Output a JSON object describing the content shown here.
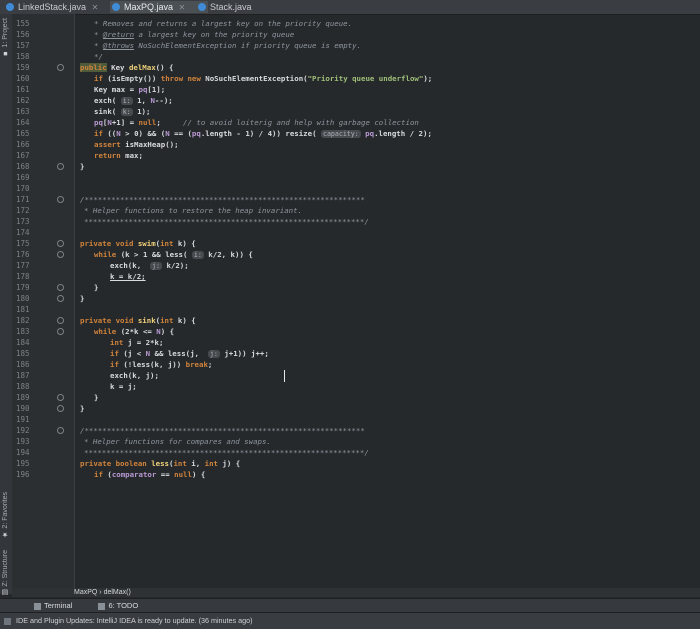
{
  "tabs": [
    {
      "label": "LinkedStack.java",
      "active": false
    },
    {
      "label": "MaxPQ.java",
      "active": true
    },
    {
      "label": "Stack.java",
      "active": false
    }
  ],
  "toolstrip": {
    "project": "1: Project",
    "favorites": "2: Favorites",
    "structure": "Z: Structure"
  },
  "gutter": {
    "line_numbers": [
      "155",
      "156",
      "157",
      "158",
      "159",
      "160",
      "161",
      "162",
      "163",
      "164",
      "165",
      "166",
      "167",
      "168",
      "169",
      "170",
      "171",
      "172",
      "173",
      "174",
      "175",
      "176",
      "177",
      "178",
      "179",
      "180",
      "181",
      "182",
      "183",
      "184",
      "185",
      "186",
      "187",
      "188",
      "189",
      "190",
      "191",
      "192",
      "193",
      "194",
      "195",
      "196"
    ]
  },
  "code": {
    "l155_a": "* Removes and returns a largest key on the priority queue.",
    "l156_a": "* ",
    "l156_tag": "@return",
    "l156_b": " a largest key on the priority queue",
    "l157_a": "* ",
    "l157_tag": "@throws",
    "l157_b": " NoSuchElementException if priority queue is empty.",
    "l158": "*/",
    "l159_kw": "public",
    "l159_b": " Key ",
    "l159_m": "delMax",
    "l159_c": "() {",
    "l160_kw": "if",
    "l160_b": " (isEmpty()) ",
    "l160_kw2": "throw new",
    "l160_c": " NoSuchElementException(",
    "l160_str": "\"Priority queue underflow\"",
    "l160_d": ");",
    "l161_a": "Key max = ",
    "l161_f": "pq",
    "l161_b": "[1];",
    "l162_a": "exch( ",
    "l162_h": "i:",
    "l162_b": " 1, ",
    "l162_f": "N",
    "l162_c": "--);",
    "l163_a": "sink( ",
    "l163_h": "k:",
    "l163_b": " 1);",
    "l164_f": "pq",
    "l164_a": "[",
    "l164_f2": "N",
    "l164_b": "+1] = ",
    "l164_kw": "null",
    "l164_c": ";     ",
    "l164_com": "// to avoid loiterig and help with garbage collection",
    "l165_kw": "if",
    "l165_a": " ((",
    "l165_f": "N",
    "l165_b": " > 0) && (",
    "l165_f2": "N",
    "l165_c": " == (",
    "l165_f3": "pq",
    "l165_d": ".length - 1) / 4)) resize( ",
    "l165_h": "capacity:",
    "l165_e": " ",
    "l165_f4": "pq",
    "l165_g": ".length / 2);",
    "l166_kw": "assert",
    "l166_a": " isMaxHeap();",
    "l167_kw": "return",
    "l167_a": " max;",
    "l168": "}",
    "l171": "/***************************************************************",
    "l172": "* Helper functions to restore the heap invariant.",
    "l173": "***************************************************************/",
    "l175_kw": "private void",
    "l175_m": " swim",
    "l175_a": "(",
    "l175_kw2": "int",
    "l175_b": " k) {",
    "l176_kw": "while",
    "l176_a": " (k > 1 && less( ",
    "l176_h": "i:",
    "l176_b": " k/2, k)) {",
    "l177_a": "exch(k,  ",
    "l177_h": "j:",
    "l177_b": " k/2);",
    "l178_a": "k = k/2;",
    "l179": "}",
    "l180": "}",
    "l182_kw": "private void",
    "l182_m": " sink",
    "l182_a": "(",
    "l182_kw2": "int",
    "l182_b": " k) {",
    "l183_kw": "while",
    "l183_a": " (2*k <= ",
    "l183_f": "N",
    "l183_b": ") {",
    "l184_kw": "int",
    "l184_a": " j = 2*k;",
    "l185_kw": "if",
    "l185_a": " (j < ",
    "l185_f": "N",
    "l185_b": " && less(j,  ",
    "l185_h": "j:",
    "l185_c": " j+1)) j++;",
    "l186_kw": "if",
    "l186_a": " (!less(k, j)) ",
    "l186_kw2": "break",
    "l186_b": ";",
    "l187_a": "exch(k, j);",
    "l188_a": "k = j;",
    "l189": "}",
    "l190": "}",
    "l192": "/***************************************************************",
    "l193": "* Helper functions for compares and swaps.",
    "l194": "***************************************************************/",
    "l195_kw": "private boolean",
    "l195_m": " less",
    "l195_a": "(",
    "l195_kw2": "int",
    "l195_b": " i, ",
    "l195_kw3": "int",
    "l195_c": " j) {",
    "l196_kw": "if",
    "l196_a": " (",
    "l196_f": "comparator",
    "l196_b": " == ",
    "l196_kw2": "null",
    "l196_c": ") {"
  },
  "breadcrumb": {
    "class": "MaxPQ",
    "sep": "›",
    "method": "delMax()"
  },
  "bottombar": {
    "terminal": "Terminal",
    "todo": "6: TODO"
  },
  "statusbar": {
    "message": "IDE and Plugin Updates: IntelliJ IDEA is ready to update. (36 minutes ago)"
  },
  "colors": {
    "background": "#26292c",
    "keyword": "#d0833b",
    "string": "#9fbf78",
    "field": "#b99ad4"
  }
}
